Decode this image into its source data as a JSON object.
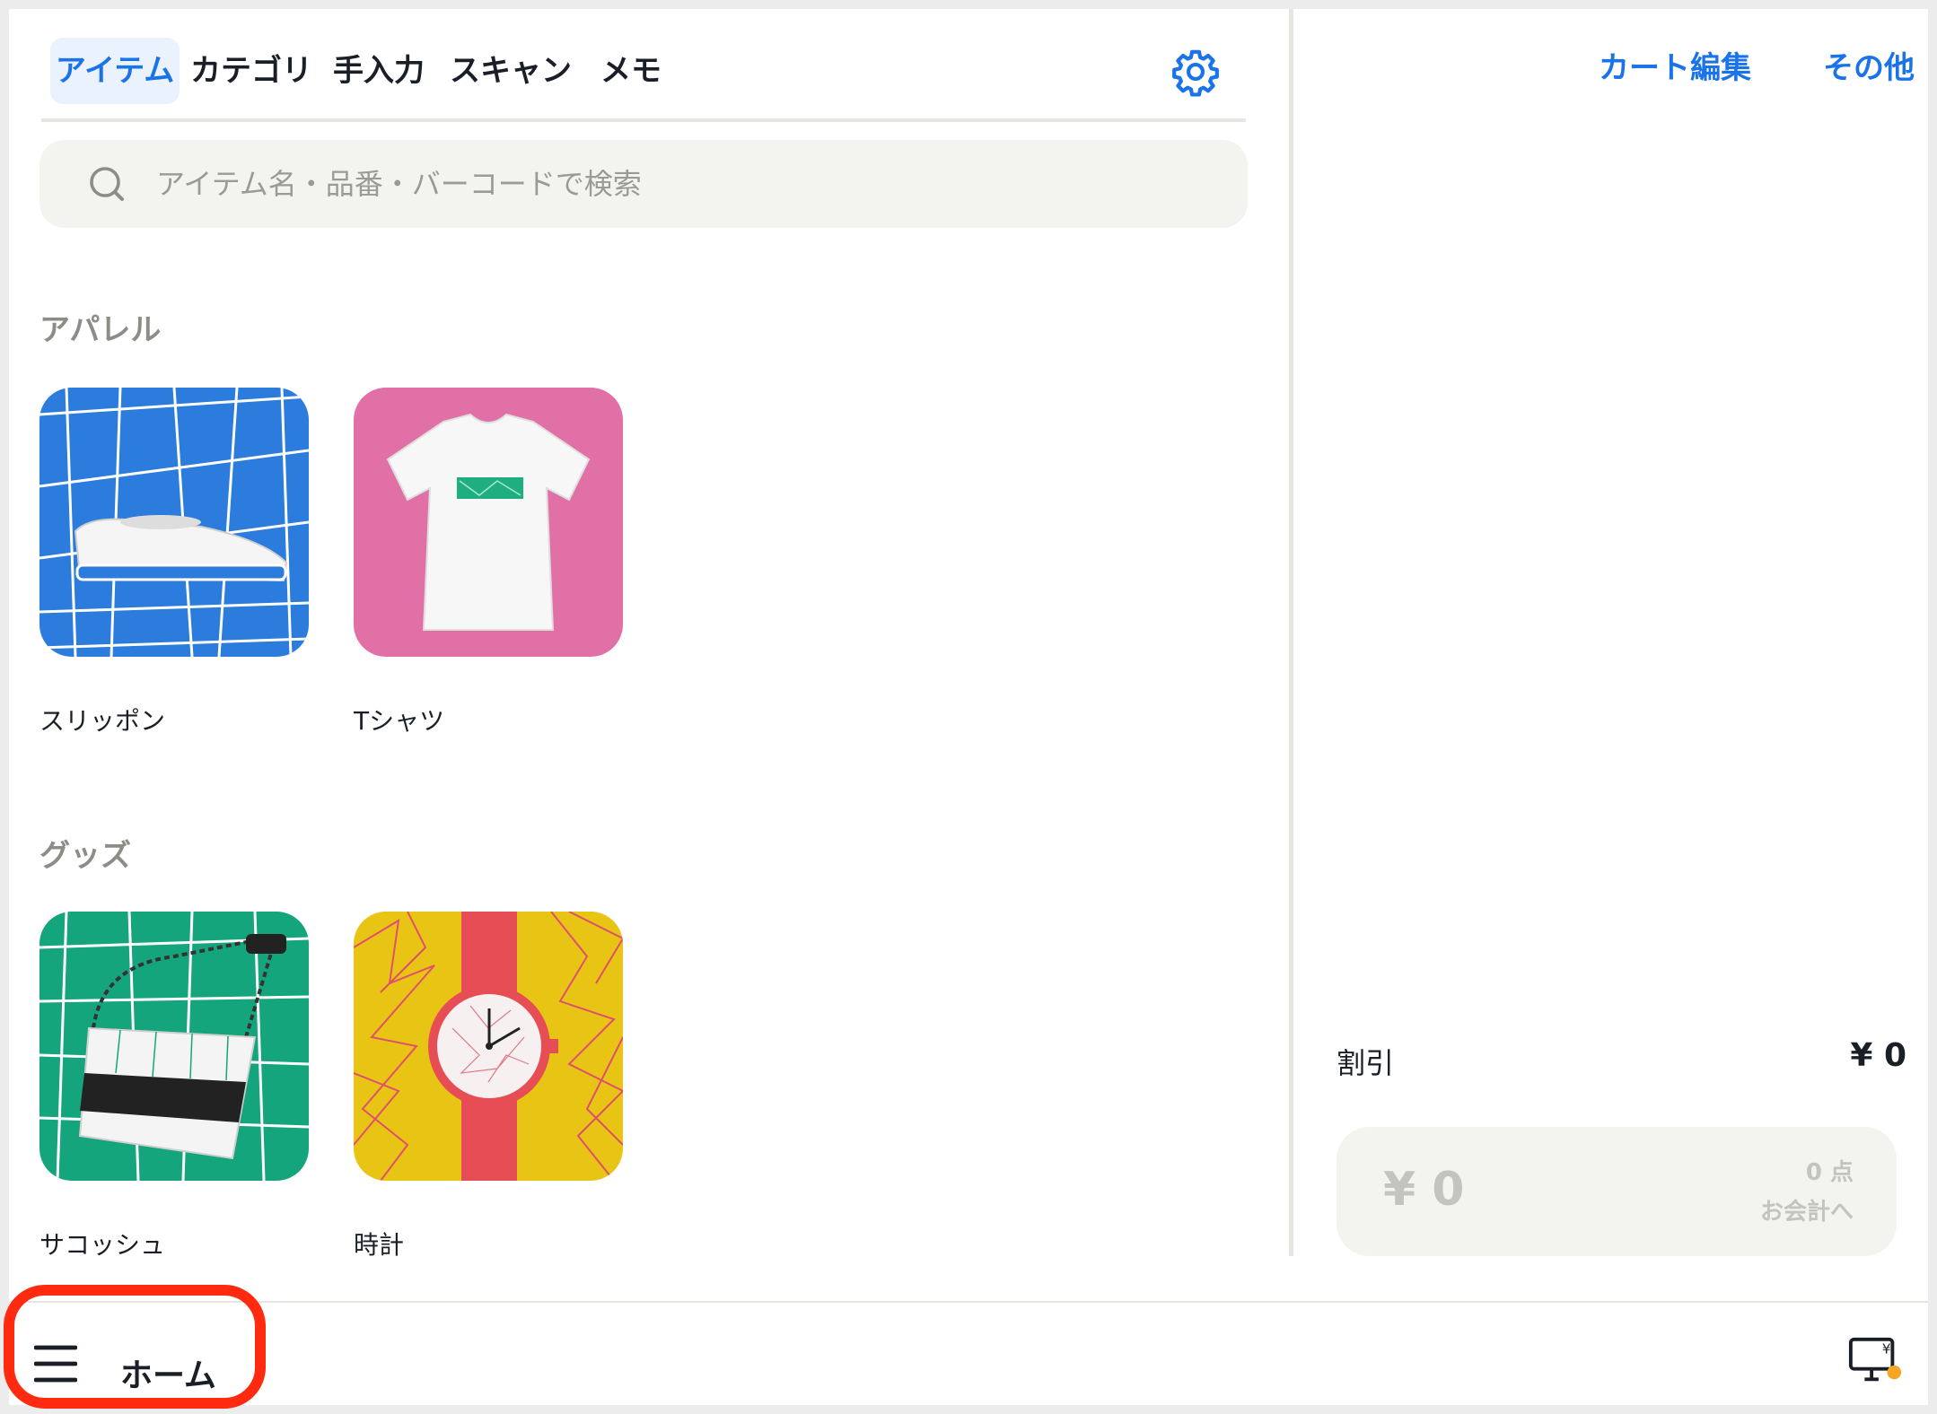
{
  "tabs": [
    {
      "label": "アイテム",
      "active": true
    },
    {
      "label": "カテゴリ",
      "active": false
    },
    {
      "label": "手入力",
      "active": false
    },
    {
      "label": "スキャン",
      "active": false
    },
    {
      "label": "メモ",
      "active": false
    }
  ],
  "search": {
    "placeholder": "アイテム名・品番・バーコードで検索"
  },
  "sections": [
    {
      "title": "アパレル",
      "items": [
        {
          "label": "スリッポン",
          "thumb": "shoe"
        },
        {
          "label": "Tシャツ",
          "thumb": "tshirt"
        }
      ]
    },
    {
      "title": "グッズ",
      "items": [
        {
          "label": "サコッシュ",
          "thumb": "bag"
        },
        {
          "label": "時計",
          "thumb": "watch"
        }
      ]
    }
  ],
  "cart": {
    "edit_label": "カート編集",
    "more_label": "その他",
    "discount_label": "割引",
    "discount_value": "¥ 0",
    "total": "¥ 0",
    "count": "0 点",
    "checkout_label": "お会計へ"
  },
  "bottom": {
    "home_label": "ホーム"
  },
  "colors": {
    "accent": "#1a73e8",
    "highlight": "#ff2a0f"
  }
}
